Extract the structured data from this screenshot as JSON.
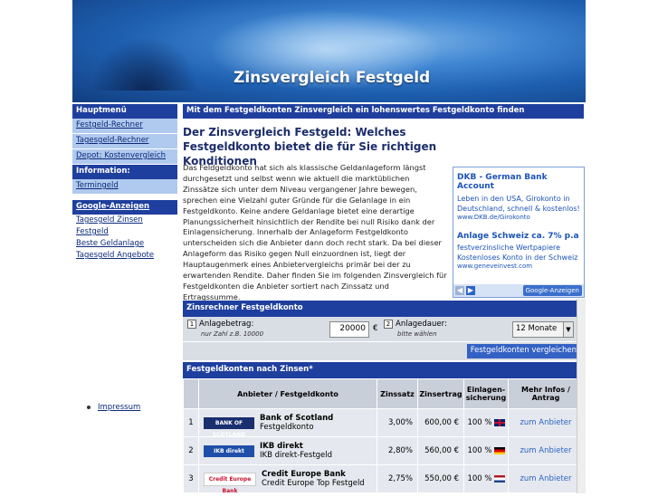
{
  "header": {
    "title": "Zinsvergleich Festgeld"
  },
  "sidebar": {
    "menu_head": "Hauptmenü",
    "menu_items": [
      {
        "label": "Festgeld-Rechner"
      },
      {
        "label": "Tagesgeld-Rechner"
      },
      {
        "label": "Depot: Kostenvergleich"
      }
    ],
    "info_head": "Information:",
    "info_items": [
      {
        "label": "Termingeld"
      }
    ],
    "google_head": "Google-Anzeigen",
    "google_items": [
      {
        "label": "Tagesgeld Zinsen"
      },
      {
        "label": "Festgeld"
      },
      {
        "label": "Beste Geldanlage"
      },
      {
        "label": "Tagesgeld Angebote"
      }
    ],
    "imprint": "Impressum"
  },
  "main": {
    "subtitle": "Mit dem Festgeldkonten Zinsvergleich ein lohenswertes Festgeldkonto finden",
    "headline": "Der Zinsvergleich Festgeld: Welches Festgeldkonto bietet die für Sie richtigen Konditionen",
    "intro": "Das Feldgeldkonto hat sich als klassische Geldanlageform längst durchgesetzt und selbst wenn wie aktuell die marktüblichen Zinssätze sich unter dem Niveau vergangener Jahre bewegen, sprechen eine Vielzahl guter Gründe für die Gelanlage in ein Festgeldkonto. Keine andere Geldanlage bietet eine derartige Planungssicherheit hinsichtlich der Rendite bei null Risiko dank der Einlagensicherung. Innerhalb der Anlageform Festgeldkonto unterscheiden sich die Anbieter dann doch recht stark. Da bei dieser Anlageform das Risiko gegen Null einzuordnen ist, liegt der Hauptaugenmerk eines Anbietervergleichs primär bei der zu erwartenden Rendite. Daher finden Sie im folgenden Zinsvergleich für Festgeldkonten die Anbieter sortiert nach Zinssatz und Ertragssumme."
  },
  "ad": {
    "ad1_title": "DKB - German Bank Account",
    "ad1_text": "Leben in den USA, Girokonto in Deutschland, schnell & kostenlos!",
    "ad1_url": "www.DKB.de/Girokonto",
    "ad2_title": "Anlage Schweiz ca. 7% p.a",
    "ad2_text": "festverzinsliche Wertpapiere Kostenloses Konto in der Schweiz",
    "ad2_url": "www.geneveinvest.com",
    "google_label": "Google-Anzeigen"
  },
  "calc": {
    "head": "Zinsrechner Festgeldkonto",
    "num1": "1",
    "amount_label": "Anlagebetrag:",
    "amount_hint": "nur Zahl z.B. 10000",
    "amount_value": "20000",
    "currency": "€",
    "num2": "2",
    "duration_label": "Anlagedauer:",
    "duration_hint": "bitte wählen",
    "duration_value": "12 Monate",
    "compare_button": "Festgeldkonten vergleichen"
  },
  "results": {
    "head": "Festgeldkonten nach Zinsen*",
    "columns": [
      "Anbieter / Festgeldkonto",
      "Zinssatz",
      "Zinsertrag",
      "Einlagen-sicherung",
      "Mehr Infos / Antrag"
    ],
    "rows": [
      {
        "rank": "1",
        "logo": "BANK OF SCOTLAND",
        "logo_color": "#1a2f6e",
        "bank": "Bank of Scotland",
        "product": "Festgeldkonto",
        "rate": "3,00%",
        "yield": "600,00 €",
        "guarantee": "100 %",
        "flag": "uk",
        "link": "zum Anbieter"
      },
      {
        "rank": "2",
        "logo": "IKB direkt",
        "logo_color": "#1f4fa8",
        "bank": "IKB direkt",
        "product": "IKB direkt-Festgeld",
        "rate": "2,80%",
        "yield": "560,00 €",
        "guarantee": "100 %",
        "flag": "de",
        "link": "zum Anbieter"
      },
      {
        "rank": "3",
        "logo": "Credit Europe Bank",
        "logo_color": "#c8102e",
        "bank": "Credit Europe Bank",
        "product": "Credit Europe Top Festgeld",
        "rate": "2,75%",
        "yield": "550,00 €",
        "guarantee": "100 %",
        "flag": "nl",
        "link": "zum Anbieter"
      }
    ]
  }
}
